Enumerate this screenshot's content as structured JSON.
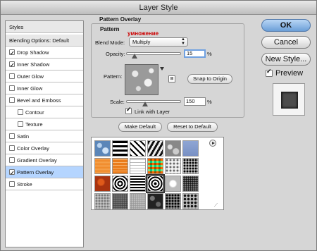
{
  "window": {
    "title": "Layer Style"
  },
  "styles_panel": {
    "items": [
      {
        "label": "Styles",
        "kind": "header",
        "checked": false
      },
      {
        "label": "Blending Options: Default",
        "kind": "header",
        "checked": false
      },
      {
        "label": "Drop Shadow",
        "kind": "check",
        "checked": true
      },
      {
        "label": "Inner Shadow",
        "kind": "check",
        "checked": true
      },
      {
        "label": "Outer Glow",
        "kind": "check",
        "checked": false
      },
      {
        "label": "Inner Glow",
        "kind": "check",
        "checked": false
      },
      {
        "label": "Bevel and Emboss",
        "kind": "check",
        "checked": false
      },
      {
        "label": "Contour",
        "kind": "sub",
        "checked": false
      },
      {
        "label": "Texture",
        "kind": "sub",
        "checked": false
      },
      {
        "label": "Satin",
        "kind": "check",
        "checked": false
      },
      {
        "label": "Color Overlay",
        "kind": "check",
        "checked": false
      },
      {
        "label": "Gradient Overlay",
        "kind": "check",
        "checked": false
      },
      {
        "label": "Pattern Overlay",
        "kind": "check",
        "checked": true,
        "selected": true
      },
      {
        "label": "Stroke",
        "kind": "check",
        "checked": false
      }
    ]
  },
  "pattern_overlay": {
    "section_title": "Pattern Overlay",
    "group_title": "Pattern",
    "annotation": "умножение",
    "blend_mode_label": "Blend Mode:",
    "blend_mode_value": "Multiply",
    "opacity_label": "Opacity:",
    "opacity_value": "15",
    "opacity_fraction": 0.15,
    "percent_sign": "%",
    "pattern_label": "Pattern:",
    "new_preset_glyph": "⊞",
    "snap_button": "Snap to Origin",
    "scale_label": "Scale:",
    "scale_value": "150",
    "scale_fraction": 0.35,
    "link_label": "Link with Layer",
    "link_checked": true,
    "make_default_button": "Make Default",
    "reset_default_button": "Reset to Default"
  },
  "pattern_picker": {
    "resize_glyph": "⟋",
    "tiles": [
      "blue-bubbles",
      "checker-strips",
      "diagonal-dots",
      "zebra-stripes",
      "gray-stone",
      "blue-wash",
      "orange-fine",
      "orange-grid",
      "white-grid",
      "rainbow-plaid",
      "white-speckle",
      "black-white-noise",
      "red-rust",
      "concentric-squares",
      "checkerboard",
      "black-swirl",
      "white-marble",
      "bw-noise",
      "gray-texture",
      "gray-noise",
      "light-noise",
      "dark-rocks",
      "mixed-noise",
      "rocky-noise"
    ]
  },
  "right_panel": {
    "ok_label": "OK",
    "cancel_label": "Cancel",
    "new_style_label": "New Style...",
    "preview_label": "Preview",
    "preview_checked": true
  },
  "colors": {
    "selection": "#b5d5ff",
    "default_button": "#6c9fd8",
    "annotation": "#cc0000"
  }
}
